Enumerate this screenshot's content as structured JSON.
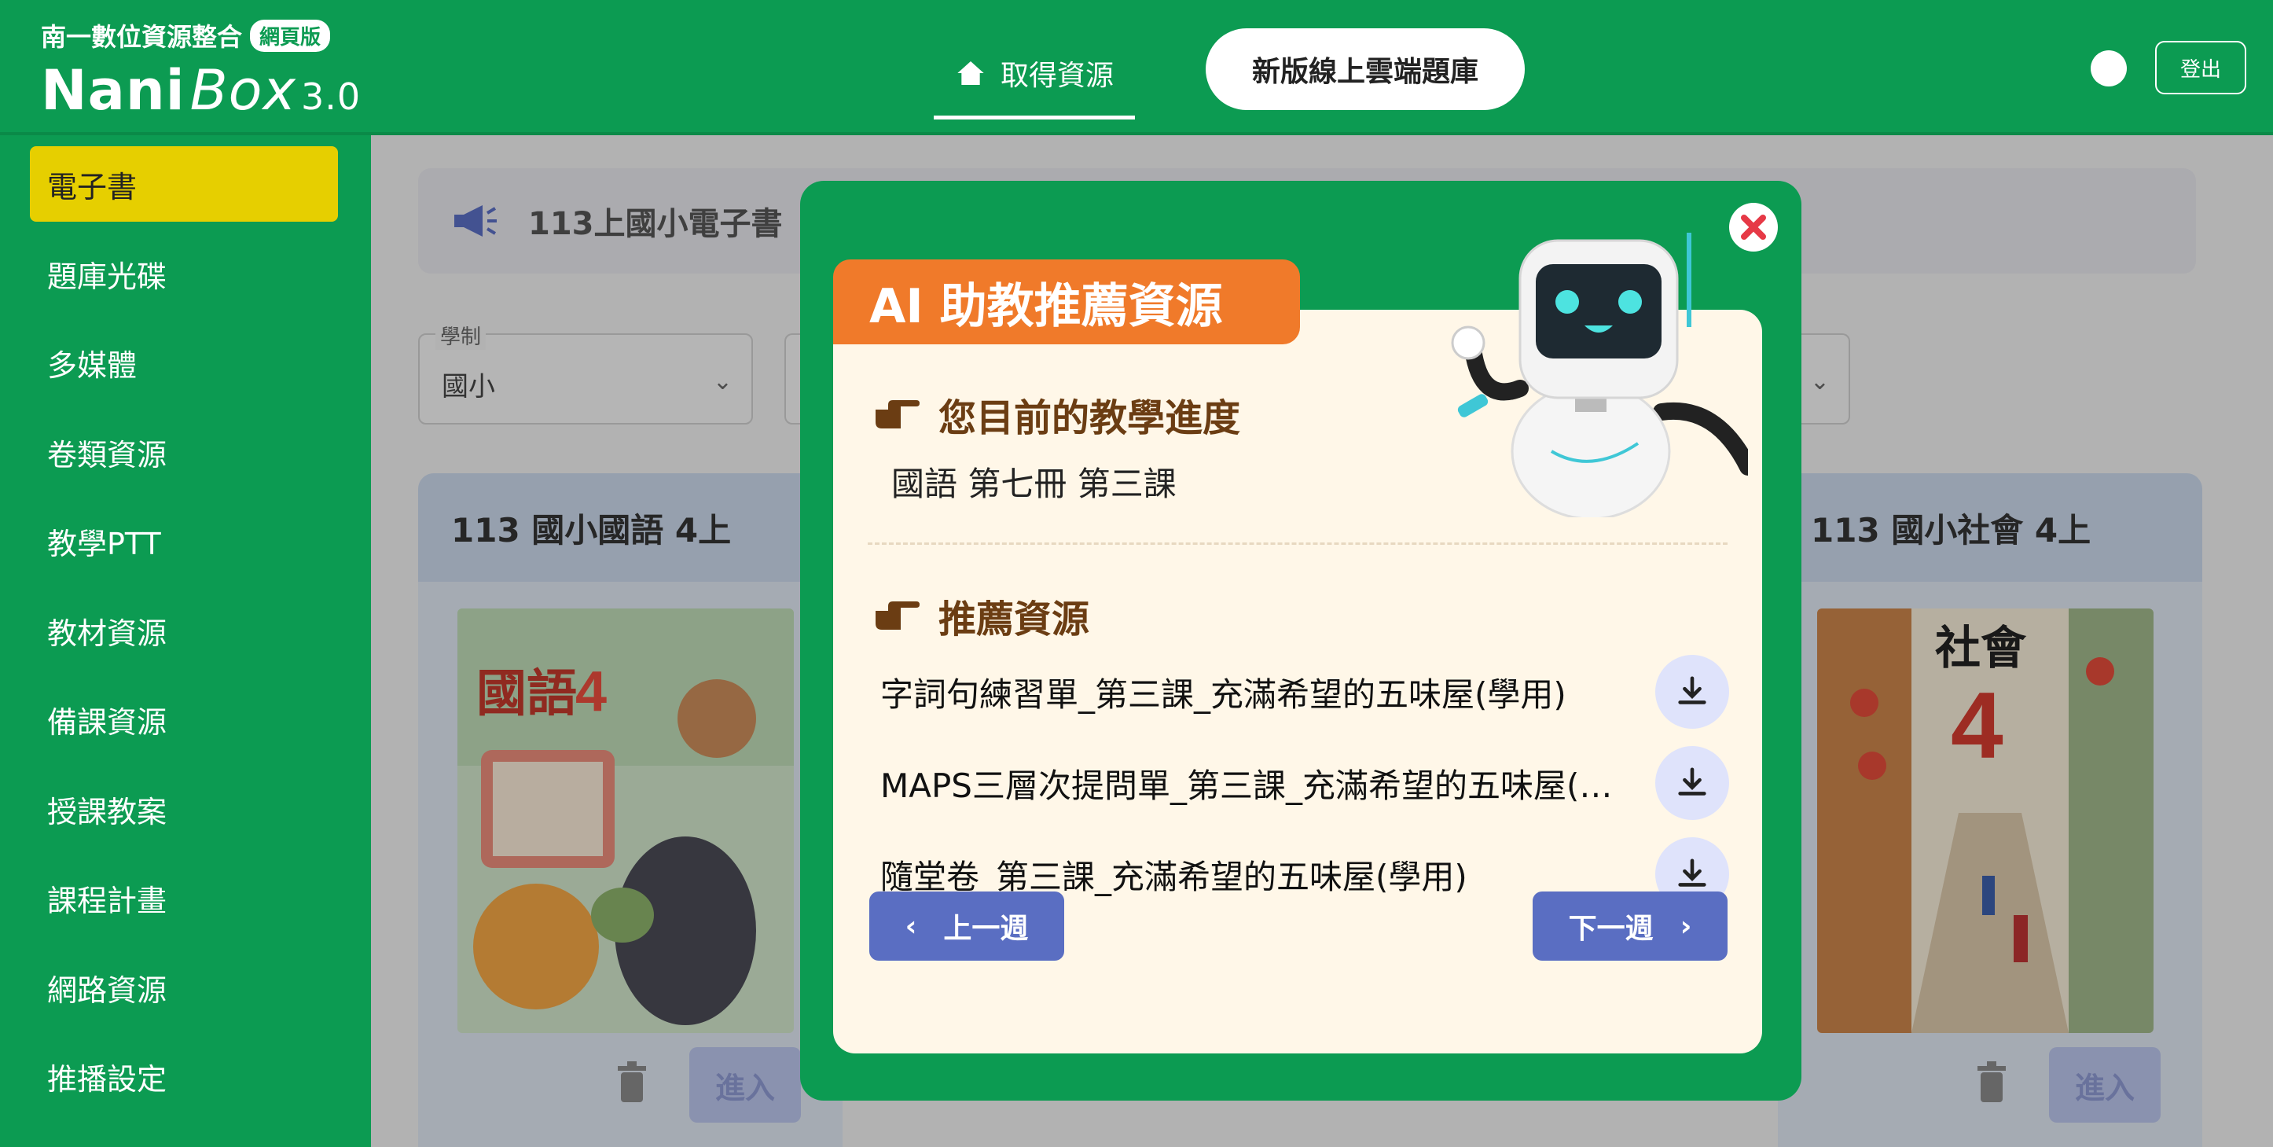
{
  "header": {
    "brand_subtitle": "南一數位資源整合",
    "brand_badge": "網頁版",
    "logo_nani": "Nani",
    "logo_box": "Box",
    "logo_version": "3.0",
    "nav_tab_label": "取得資源",
    "nav_pill_label": "新版線上雲端題庫",
    "logout_label": "登出"
  },
  "sidebar": {
    "items": [
      {
        "label": "電子書",
        "active": true
      },
      {
        "label": "題庫光碟"
      },
      {
        "label": "多媒體"
      },
      {
        "label": "卷類資源"
      },
      {
        "label": "教學PTT"
      },
      {
        "label": "教材資源"
      },
      {
        "label": "備課資源"
      },
      {
        "label": "授課教案"
      },
      {
        "label": "課程計畫"
      },
      {
        "label": "網路資源"
      },
      {
        "label": "推播設定"
      }
    ]
  },
  "main": {
    "announcement": "113上國小電子書",
    "filters": [
      {
        "label": "學制",
        "value": "國小"
      }
    ],
    "cards": [
      {
        "title": "113 國小國語 4上",
        "enter_label": "進入",
        "cover_title": "國語",
        "cover_grade": "4"
      },
      {
        "title": "113 國小社會 4上",
        "enter_label": "進入",
        "cover_title": "社會",
        "cover_grade": "4"
      }
    ]
  },
  "modal": {
    "banner_title": "AI 助教推薦資源",
    "progress_heading": "您目前的教學進度",
    "progress_value": "國語 第七冊 第三課",
    "resources_heading": "推薦資源",
    "resources": [
      {
        "label": "字詞句練習單_第三課_充滿希望的五味屋(學用)"
      },
      {
        "label": "MAPS三層次提問單_第三課_充滿希望的五味屋(學用)"
      },
      {
        "label": "隨堂卷_第三課_充滿希望的五味屋(學用)"
      }
    ],
    "prev_label": "上一週",
    "next_label": "下一週"
  },
  "colors": {
    "brand_green": "#0c9b52",
    "active_yellow": "#e6cf00",
    "banner_orange": "#f07a2a",
    "panel_cream": "#fff7e8",
    "button_blue": "#5a6ec2",
    "close_red": "#e63946"
  },
  "icons": {
    "nav_tab": "home-icon",
    "announce": "megaphone-icon",
    "heading": "pointing-hand-icon",
    "download": "download-icon",
    "close": "close-icon",
    "card_delete": "trash-icon"
  }
}
